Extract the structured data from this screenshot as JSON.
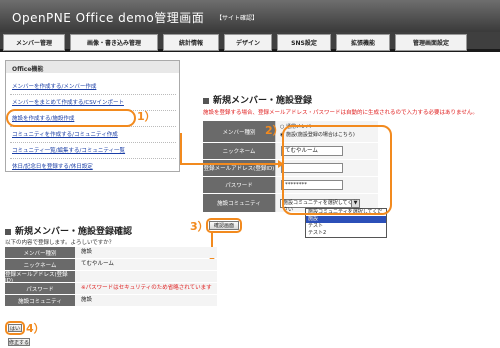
{
  "header": {
    "title": "OpenPNE Office demo管理画面",
    "site_link": "【サイト確認】"
  },
  "nav": {
    "tabs": [
      "メンバー管理",
      "画像・書き込み管理",
      "統計情報",
      "デザイン",
      "SNS設定",
      "拡張機能",
      "管理画面設定"
    ]
  },
  "sidebar": {
    "heading": "Office機能",
    "items": [
      "メンバーを作成する/メンバー作成",
      "メンバーをまとめて作成する/CSVインポート",
      "施設を作成する/施設作成",
      "コミュニティを作成する/コミュニティ作成",
      "コミュニティ一覧/編集する/コミュニティ一覧",
      "休日/記念日を登録する/休日設定"
    ]
  },
  "register": {
    "title": "新規メンバー・施設登録",
    "warning": "施設を登録する場合、登録メールアドレス・パスワードは自動的に生成されるので入力する必要はありません。",
    "labels": {
      "type": "メンバー種別",
      "nickname": "ニックネーム",
      "email": "登録メールアドレス(登録ID)",
      "password": "パスワード",
      "community": "施設コミュニティ"
    },
    "radio_normal": "通常メンバー",
    "radio_facility": "施設(施設登録の場合はこちら)",
    "nickname_value": "てむやルーム",
    "password_value": "********",
    "community_selected": "施設コミュニティを選択してください",
    "dropdown_options": [
      "施設コミュニティを選択してください",
      "施設",
      "テスト",
      "テスト2"
    ],
    "confirm_button": "確認画面"
  },
  "confirm": {
    "title": "新規メンバー・施設登録確認",
    "subtitle": "以下の内容で登録します。よろしいですか？",
    "rows": [
      {
        "label": "メンバー種別",
        "value": "施設"
      },
      {
        "label": "ニックネーム",
        "value": "てむやルーム"
      },
      {
        "label": "登録メールアドレス(登録ID)",
        "value": ""
      },
      {
        "label": "パスワード",
        "value": "※パスワードはセキュリティのため省略されています"
      },
      {
        "label": "施設コミュニティ",
        "value": "施設"
      }
    ],
    "yes_button": "はい",
    "back_button": "修正する"
  },
  "annotations": {
    "n1": "1）",
    "n2": "2）",
    "n3": "3）",
    "n4": "4）"
  },
  "colors": {
    "accent": "#f28a1e",
    "warning": "#e02020",
    "link": "#1a3ea6",
    "header_bg": "#4a4a4a"
  }
}
